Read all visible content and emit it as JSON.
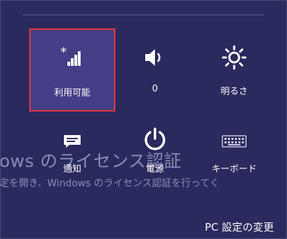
{
  "panel": {
    "tiles": [
      {
        "label": "利用可能"
      },
      {
        "label": "0"
      },
      {
        "label": "明るさ"
      },
      {
        "label": "通知"
      },
      {
        "label": "電源"
      },
      {
        "label": "キーボード"
      }
    ],
    "pc_settings_label": "PC 設定の変更"
  },
  "background": {
    "title_fragment": "ows のライセンス認証",
    "subtitle_fragment": "定を開き、Windows のライセンス認証を行ってく"
  },
  "colors": {
    "panel_bg": "#2a2a5e",
    "selected_bg": "#453e86",
    "selected_border": "#e23a3a",
    "text": "#ffffff",
    "watermark_text": "#8c8cb8"
  },
  "icons": [
    "network-icon",
    "volume-icon",
    "brightness-icon",
    "notifications-icon",
    "power-icon",
    "keyboard-icon"
  ]
}
